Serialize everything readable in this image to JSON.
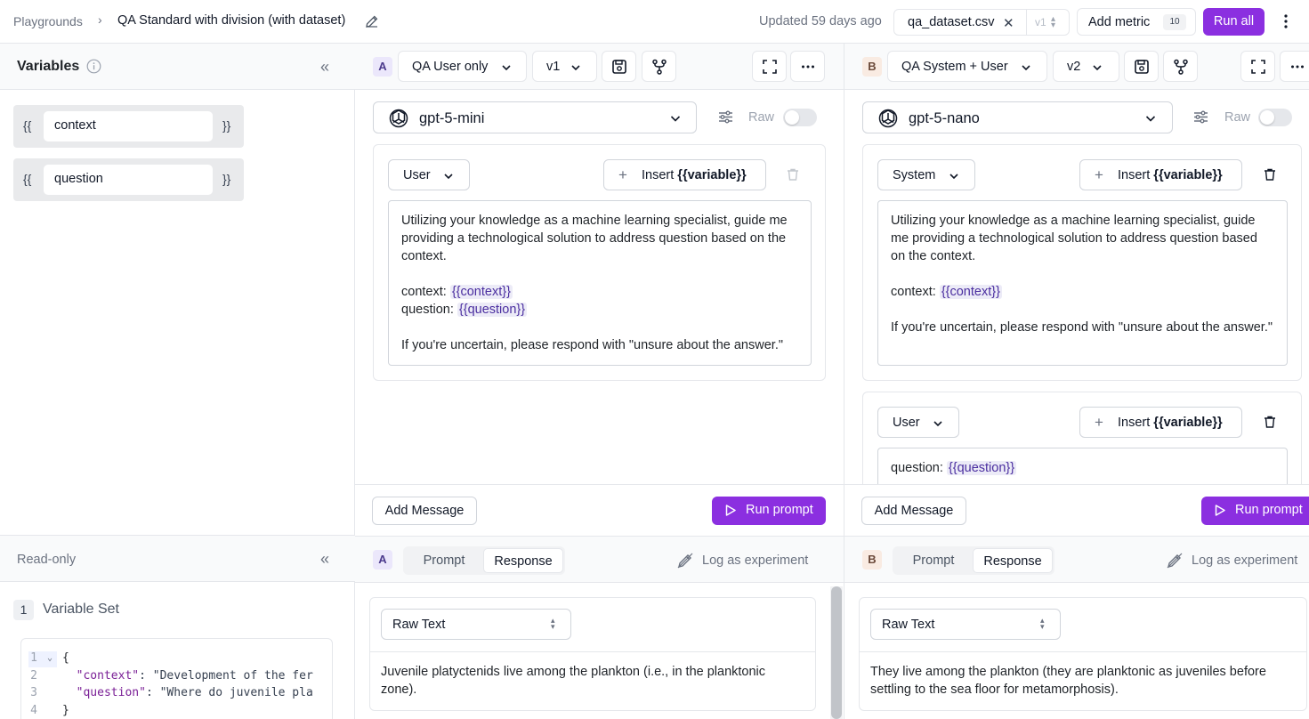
{
  "topbar": {
    "breadcrumb_root": "Playgrounds",
    "breadcrumb_sep": "›",
    "breadcrumb_current": "QA Standard with division (with dataset)",
    "updated": "Updated 59 days ago",
    "dataset_name": "qa_dataset.csv",
    "dataset_close": "✕",
    "dataset_version": "v1",
    "add_metric_label": "Add metric",
    "metric_count": "10",
    "run_all_label": "Run all"
  },
  "variables": {
    "title": "Variables",
    "collapse": "«",
    "open_brace": "{{",
    "close_brace": "}}",
    "items": [
      {
        "name": "context"
      },
      {
        "name": "question"
      }
    ]
  },
  "readonly": {
    "title": "Read-only",
    "collapse": "«",
    "set_number": "1",
    "set_title": "Variable Set",
    "code_lines": [
      {
        "n": "1",
        "pre": "{",
        "key": "",
        "val": ""
      },
      {
        "n": "2",
        "pre": "  ",
        "key": "\"context\"",
        "val": ": \"Development of the fer"
      },
      {
        "n": "3",
        "pre": "  ",
        "key": "\"question\"",
        "val": ": \"Where do juvenile pla"
      },
      {
        "n": "4",
        "pre": "}",
        "key": "",
        "val": ""
      }
    ]
  },
  "columns": {
    "a": {
      "letter": "A",
      "prompt_name": "QA User only",
      "version": "v1",
      "model": "gpt-5-mini",
      "raw_label": "Raw",
      "messages": [
        {
          "role": "User",
          "insert_prefix": "Insert ",
          "insert_var": "{{variable}}",
          "line1": "Utilizing your knowledge as a machine learning specialist, guide me providing a technological solution to address question based on the context.",
          "ctx_label": "context: ",
          "ctx_tag": "{{context}}",
          "q_label": "question: ",
          "q_tag": "{{question}}",
          "closing": "If you're uncertain, please respond with \"unsure about the answer.\""
        }
      ],
      "add_message": "Add Message",
      "run_prompt": "Run prompt",
      "tab_prompt": "Prompt",
      "tab_response": "Response",
      "log_experiment": "Log as experiment",
      "response_format": "Raw Text",
      "response_text": "Juvenile platyctenids live among the plankton (i.e., in the planktonic zone)."
    },
    "b": {
      "letter": "B",
      "prompt_name": "QA System + User",
      "version": "v2",
      "model": "gpt-5-nano",
      "raw_label": "Raw",
      "messages": [
        {
          "role": "System",
          "insert_prefix": "Insert ",
          "insert_var": "{{variable}}",
          "line1": "Utilizing your knowledge as a machine learning specialist, guide me providing a technological solution to address question based on the context.",
          "ctx_label": "context: ",
          "ctx_tag": "{{context}}",
          "closing": "If you're uncertain, please respond with \"unsure about the answer.\""
        },
        {
          "role": "User",
          "insert_prefix": "Insert ",
          "insert_var": "{{variable}}",
          "q_label": "question: ",
          "q_tag": "{{question}}"
        }
      ],
      "add_message": "Add Message",
      "run_prompt": "Run prompt",
      "tab_prompt": "Prompt",
      "tab_response": "Response",
      "log_experiment": "Log as experiment",
      "response_format": "Raw Text",
      "response_text": "They live among the plankton (they are planktonic as juveniles before settling to the sea floor for metamorphosis)."
    }
  },
  "colors": {
    "accent": "#8b2fe0",
    "variable_tag_bg": "#ecebf7",
    "letter_a_bg": "#ebe7fb",
    "letter_b_bg": "#f9ebe2"
  }
}
